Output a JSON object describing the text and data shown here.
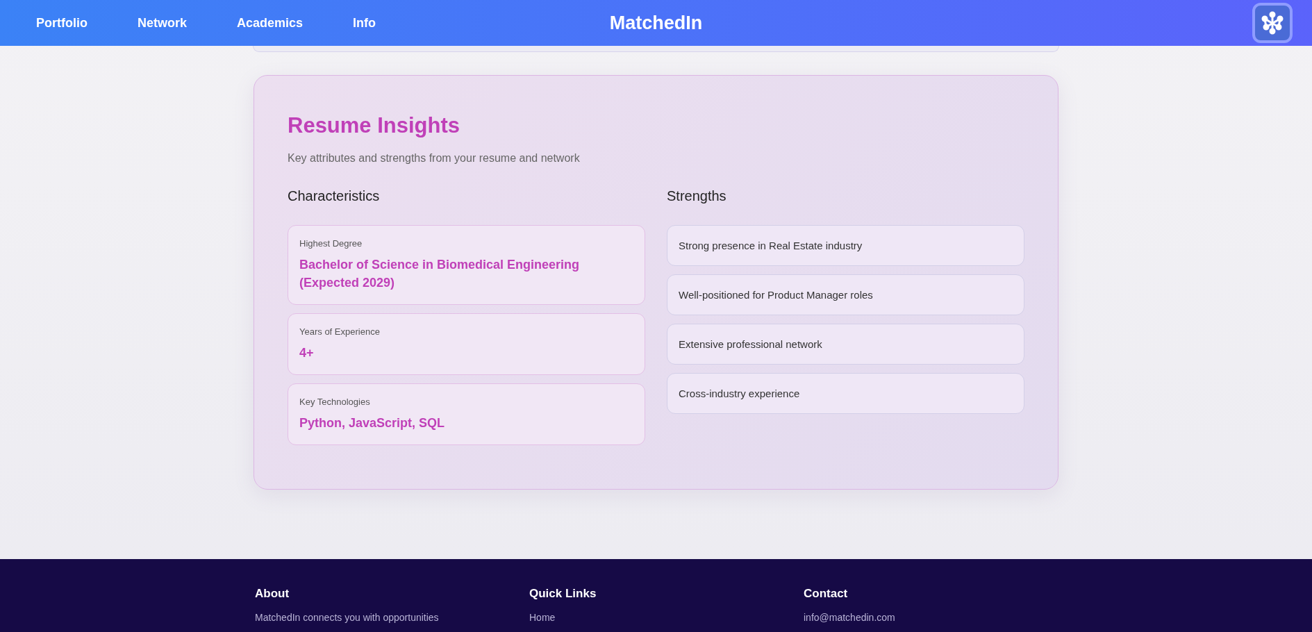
{
  "nav": {
    "links": [
      "Portfolio",
      "Network",
      "Academics",
      "Info"
    ],
    "brand": "MatchedIn"
  },
  "insights": {
    "title": "Resume Insights",
    "subtitle": "Key attributes and strengths from your resume and network",
    "characteristics": {
      "heading": "Characteristics",
      "items": [
        {
          "label": "Highest Degree",
          "value": "Bachelor of Science in Biomedical Engineering (Expected 2029)"
        },
        {
          "label": "Years of Experience",
          "value": "4+"
        },
        {
          "label": "Key Technologies",
          "value": "Python, JavaScript, SQL"
        }
      ]
    },
    "strengths": {
      "heading": "Strengths",
      "items": [
        "Strong presence in Real Estate industry",
        "Well-positioned for Product Manager roles",
        "Extensive professional network",
        "Cross-industry experience"
      ]
    }
  },
  "footer": {
    "columns": [
      {
        "heading": "About",
        "text": "MatchedIn connects you with opportunities"
      },
      {
        "heading": "Quick Links",
        "text": "Home"
      },
      {
        "heading": "Contact",
        "text": "info@matchedin.com"
      }
    ]
  }
}
